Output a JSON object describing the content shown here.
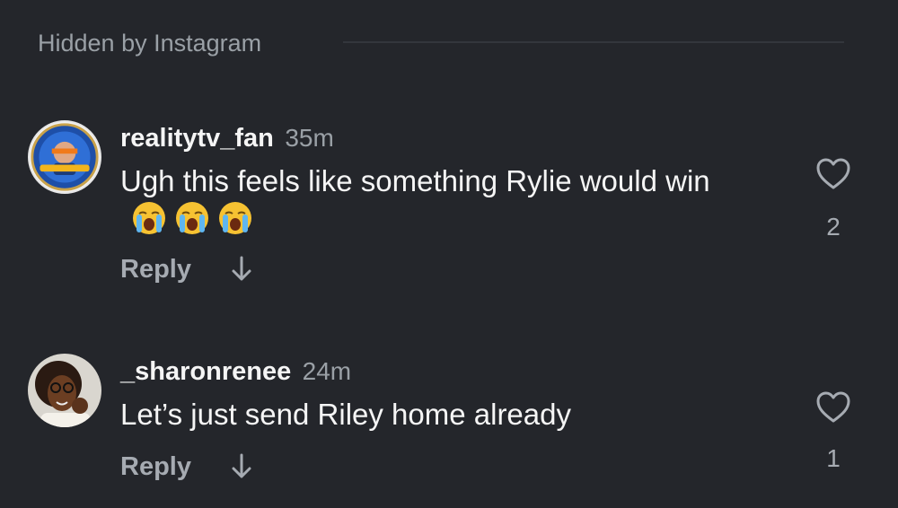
{
  "hidden_section": {
    "label": "Hidden by Instagram"
  },
  "comments": [
    {
      "username": "realitytv_fan",
      "time": "35m",
      "text": "Ugh this feels like something Rylie would win",
      "emojis": [
        "loudly-crying-face",
        "loudly-crying-face",
        "loudly-crying-face"
      ],
      "reply_label": "Reply",
      "likes": "2"
    },
    {
      "username": "_sharonrenee",
      "time": "24m",
      "text": "Let’s just send Riley home already",
      "reply_label": "Reply",
      "likes": "1"
    }
  ],
  "colors": {
    "background": "#24262b",
    "primary_text": "#f5f5f5",
    "secondary_text": "#9aa0a6"
  }
}
